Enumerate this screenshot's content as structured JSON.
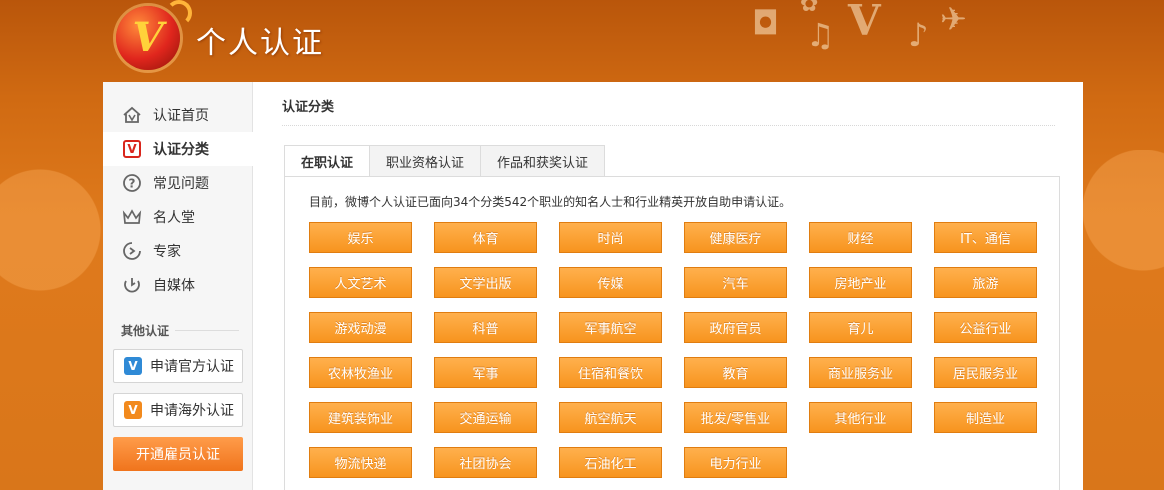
{
  "header": {
    "logo_letter": "V",
    "title": "个人认证"
  },
  "sidebar": {
    "items": [
      {
        "label": "认证首页",
        "icon": "house-v-icon",
        "active": false
      },
      {
        "label": "认证分类",
        "icon": "v-badge-icon",
        "active": true
      },
      {
        "label": "常见问题",
        "icon": "question-icon",
        "active": false
      },
      {
        "label": "名人堂",
        "icon": "crown-icon",
        "active": false
      },
      {
        "label": "专家",
        "icon": "expert-icon",
        "active": false
      },
      {
        "label": "自媒体",
        "icon": "self-media-icon",
        "active": false
      }
    ],
    "other_title": "其他认证",
    "apply_official": "申请官方认证",
    "apply_overseas": "申请海外认证",
    "employee_button": "开通雇员认证"
  },
  "main": {
    "section_title": "认证分类",
    "tabs": [
      {
        "label": "在职认证",
        "active": true
      },
      {
        "label": "职业资格认证",
        "active": false
      },
      {
        "label": "作品和获奖认证",
        "active": false
      }
    ],
    "intro": "目前，微博个人认证已面向34个分类542个职业的知名人士和行业精英开放自助申请认证。",
    "categories": [
      "娱乐",
      "体育",
      "时尚",
      "健康医疗",
      "财经",
      "IT、通信",
      "人文艺术",
      "文学出版",
      "传媒",
      "汽车",
      "房地产业",
      "旅游",
      "游戏动漫",
      "科普",
      "军事航空",
      "政府官员",
      "育儿",
      "公益行业",
      "农林牧渔业",
      "军事",
      "住宿和餐饮",
      "教育",
      "商业服务业",
      "居民服务业",
      "建筑装饰业",
      "交通运输",
      "航空航天",
      "批发/零售业",
      "其他行业",
      "制造业",
      "物流快递",
      "社团协会",
      "石油化工",
      "电力行业"
    ]
  },
  "colors": {
    "brand_orange": "#f7941e",
    "header_bg": "#c9620f",
    "accent_red": "#d9261c",
    "accent_blue": "#2f8ad6"
  }
}
